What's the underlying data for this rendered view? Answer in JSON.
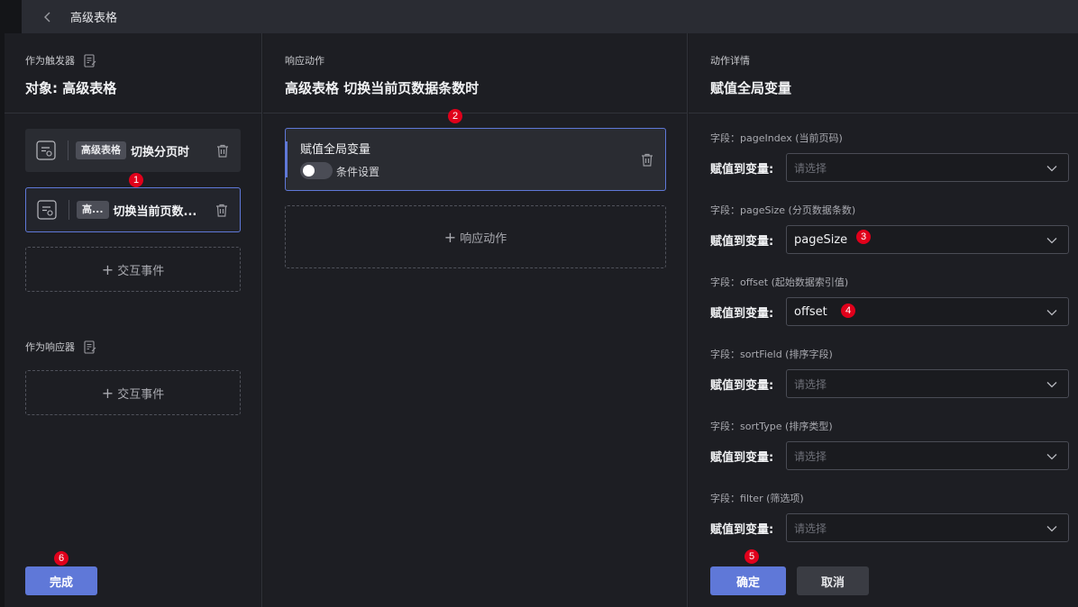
{
  "topbar": {
    "title": "高级表格"
  },
  "left": {
    "trigger_label": "作为触发器",
    "object_title": "对象: 高级表格",
    "events": [
      {
        "tag": "高级表格",
        "text": "切换分页时"
      },
      {
        "tag": "高...",
        "text": "切换当前页数..."
      }
    ],
    "add_event_label": "交互事件",
    "responder_label": "作为响应器",
    "add_event_label_2": "交互事件",
    "done_label": "完成"
  },
  "mid": {
    "section_label": "响应动作",
    "title": "高级表格 切换当前页数据条数时",
    "action": {
      "title": "赋值全局变量",
      "toggle_label": "条件设置"
    },
    "add_action_label": "响应动作"
  },
  "right": {
    "section_label": "动作详情",
    "title": "赋值全局变量",
    "assign_label": "赋值到变量:",
    "placeholder": "请选择",
    "fields": [
      {
        "label": "字段：pageIndex (当前页码)",
        "value": ""
      },
      {
        "label": "字段：pageSize (分页数据条数)",
        "value": "pageSize"
      },
      {
        "label": "字段：offset (起始数据索引值)",
        "value": "offset"
      },
      {
        "label": "字段：sortField (排序字段)",
        "value": ""
      },
      {
        "label": "字段：sortType (排序类型)",
        "value": ""
      },
      {
        "label": "字段：filter (筛选项)",
        "value": ""
      }
    ],
    "confirm_label": "确定",
    "cancel_label": "取消"
  },
  "badges": [
    "1",
    "2",
    "3",
    "4",
    "5",
    "6"
  ],
  "colors": {
    "accent": "#5f78d8",
    "badge": "#e0001b",
    "background": "#1d1e23"
  }
}
